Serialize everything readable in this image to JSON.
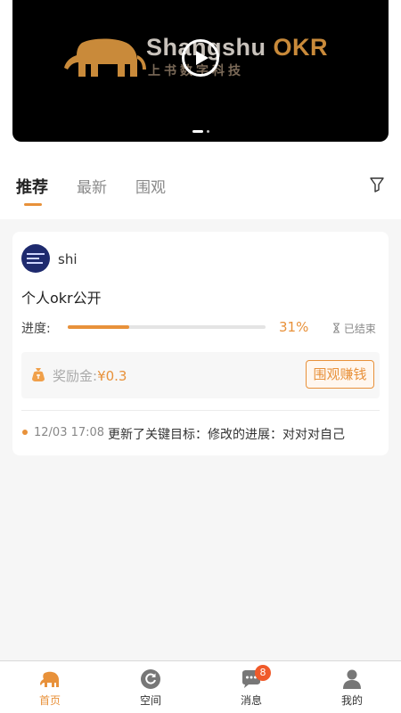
{
  "banner": {
    "brand_en": "Shangshu",
    "brand_okr": "OKR",
    "brand_cn": "上书数字科技",
    "slide_count": 2,
    "active_slide": 1
  },
  "tabs": [
    {
      "label": "推荐",
      "active": true
    },
    {
      "label": "最新",
      "active": false
    },
    {
      "label": "围观",
      "active": false
    }
  ],
  "card": {
    "username": "shi",
    "title": "个人okr公开",
    "progress_label": "进度:",
    "progress_value": 0.31,
    "progress_text": "31%",
    "status": "已结束",
    "reward_label": "奖励金:",
    "reward_amount": "¥0.3",
    "watch_button": "围观赚钱",
    "update_time": "12/03 17:08",
    "update_text": "更新了关键目标：修改的进展：对对对自己"
  },
  "nav": [
    {
      "label": "首页",
      "icon": "elephant-icon",
      "active": true
    },
    {
      "label": "空间",
      "icon": "refresh-icon",
      "active": false
    },
    {
      "label": "消息",
      "icon": "chat-icon",
      "active": false,
      "badge": "8"
    },
    {
      "label": "我的",
      "icon": "person-icon",
      "active": false
    }
  ],
  "colors": {
    "accent": "#e8913a",
    "badge": "#f05a2a"
  }
}
